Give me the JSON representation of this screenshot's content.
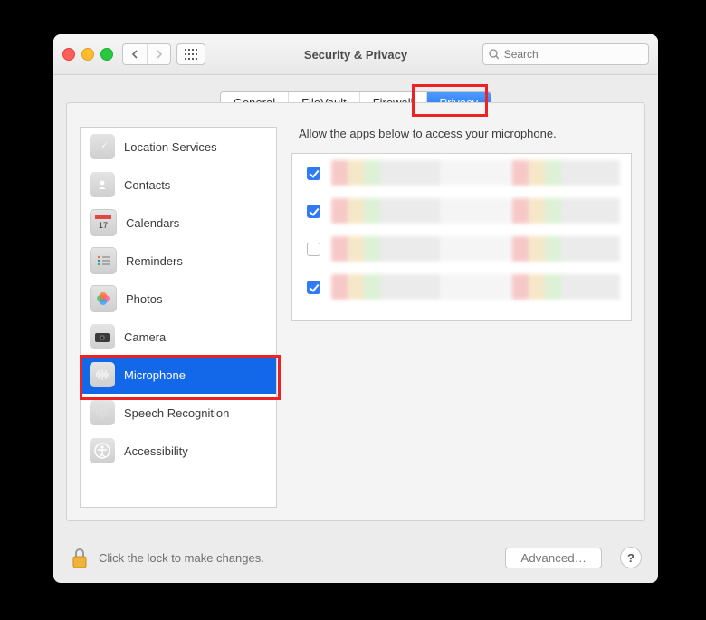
{
  "window": {
    "title": "Security & Privacy",
    "search_placeholder": "Search"
  },
  "tabs": [
    {
      "label": "General",
      "active": false
    },
    {
      "label": "FileVault",
      "active": false
    },
    {
      "label": "Firewall",
      "active": false
    },
    {
      "label": "Privacy",
      "active": true
    }
  ],
  "sidebar": {
    "items": [
      {
        "label": "Location Services",
        "icon": "location-icon",
        "selected": false
      },
      {
        "label": "Contacts",
        "icon": "contacts-icon",
        "selected": false
      },
      {
        "label": "Calendars",
        "icon": "calendar-icon",
        "selected": false
      },
      {
        "label": "Reminders",
        "icon": "reminders-icon",
        "selected": false
      },
      {
        "label": "Photos",
        "icon": "photos-icon",
        "selected": false
      },
      {
        "label": "Camera",
        "icon": "camera-icon",
        "selected": false
      },
      {
        "label": "Microphone",
        "icon": "microphone-icon",
        "selected": true
      },
      {
        "label": "Speech Recognition",
        "icon": "speech-icon",
        "selected": false
      },
      {
        "label": "Accessibility",
        "icon": "accessibility-icon",
        "selected": false
      }
    ]
  },
  "detail": {
    "hint": "Allow the apps below to access your microphone.",
    "apps": [
      {
        "checked": true
      },
      {
        "checked": true
      },
      {
        "checked": false
      },
      {
        "checked": true
      }
    ]
  },
  "footer": {
    "lock_text": "Click the lock to make changes.",
    "advanced_label": "Advanced…",
    "help_label": "?"
  },
  "highlights": [
    {
      "name": "tab-privacy-highlight"
    },
    {
      "name": "sidebar-microphone-highlight"
    }
  ]
}
